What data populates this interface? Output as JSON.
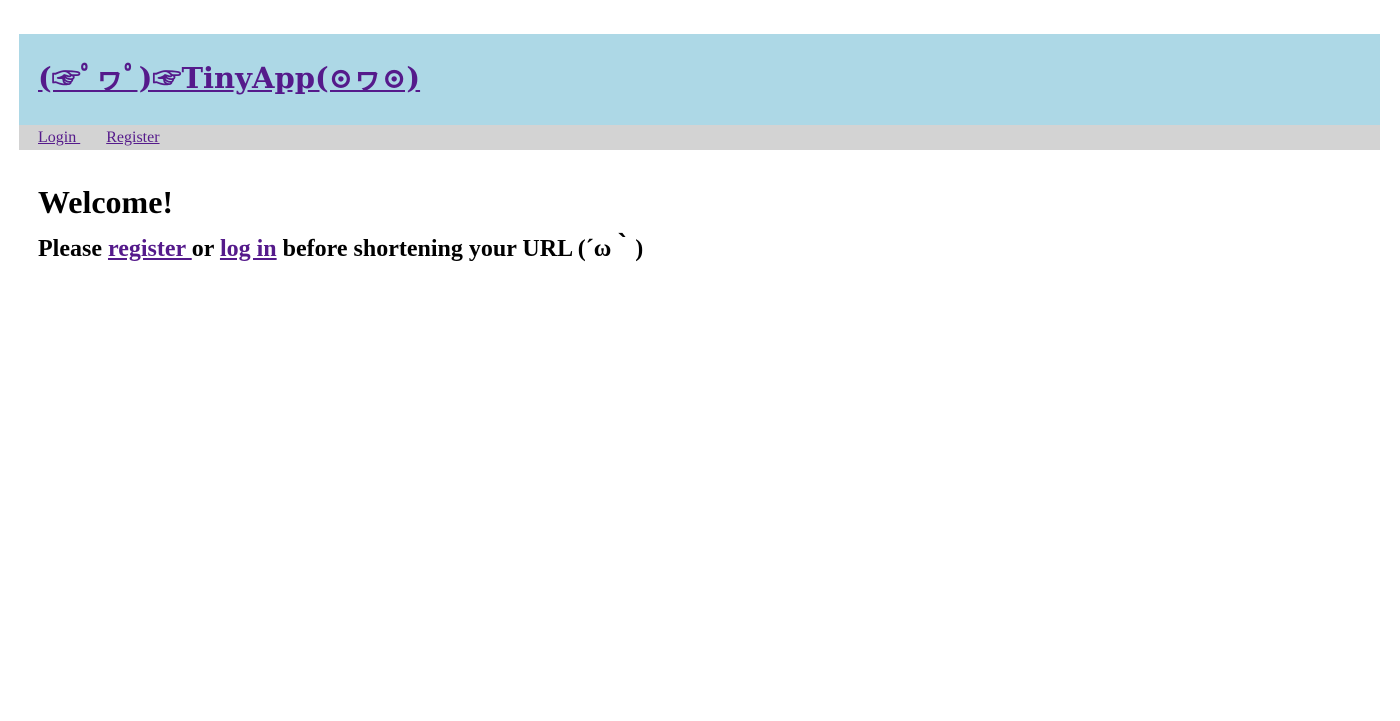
{
  "header": {
    "brand": "(☞ﾟヮﾟ)☞TinyApp(⊙ヮ⊙)"
  },
  "nav": {
    "login_label": "Login ",
    "register_label": "Register"
  },
  "main": {
    "welcome": "Welcome!",
    "message": {
      "prefix": "Please ",
      "register_link": "register ",
      "middle": "or ",
      "login_link": "log in",
      "suffix": " before shortening your URL (´ω｀)"
    }
  },
  "colors": {
    "header_bg": "#add8e6",
    "nav_bg": "#d3d3d3",
    "link": "#551a8b"
  }
}
